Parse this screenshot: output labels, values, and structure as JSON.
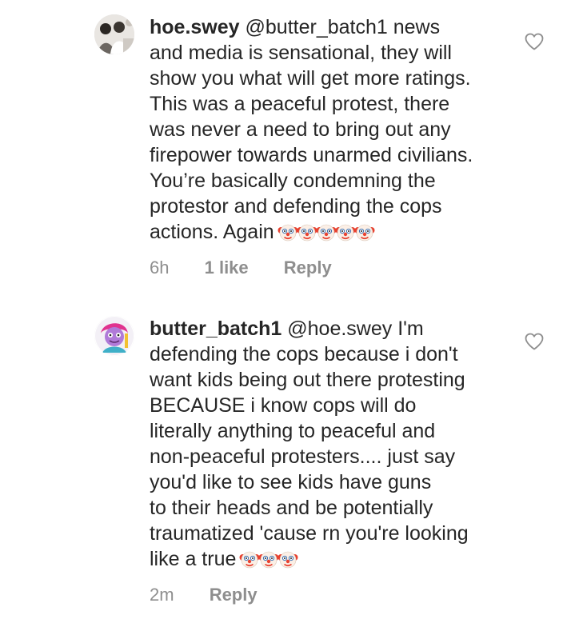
{
  "comments": [
    {
      "username": "hoe.swey",
      "lines": [
        "@butter_batch1 news",
        "and media is sensational, they will",
        "show you what will get more ratings.",
        "This was a peaceful protest, there",
        "was never a need to bring out any",
        "firepower towards unarmed civilians.",
        "You’re basically condemning the",
        "protestor and defending the cops",
        "actions. Again"
      ],
      "emoji_count": 5,
      "emoji_icon": "clown-face-icon",
      "time": "6h",
      "likes": "1 like",
      "reply_label": "Reply"
    },
    {
      "username": "butter_batch1",
      "lines": [
        "@hoe.swey I'm",
        "defending the cops because i don't",
        "want kids being out there protesting",
        "BECAUSE i know cops will do",
        "literally anything to peaceful and",
        "non-peaceful protesters.... just say",
        "you'd like to see kids have guns",
        "to their heads and be potentially",
        "traumatized 'cause rn you're looking",
        "like a true"
      ],
      "emoji_count": 3,
      "emoji_icon": "clown-face-icon",
      "time": "2m",
      "likes": "",
      "reply_label": "Reply"
    }
  ],
  "icons": {
    "like": "heart-outline-icon"
  },
  "colors": {
    "text": "#262626",
    "secondary": "#8e8e8e",
    "background": "#ffffff"
  }
}
